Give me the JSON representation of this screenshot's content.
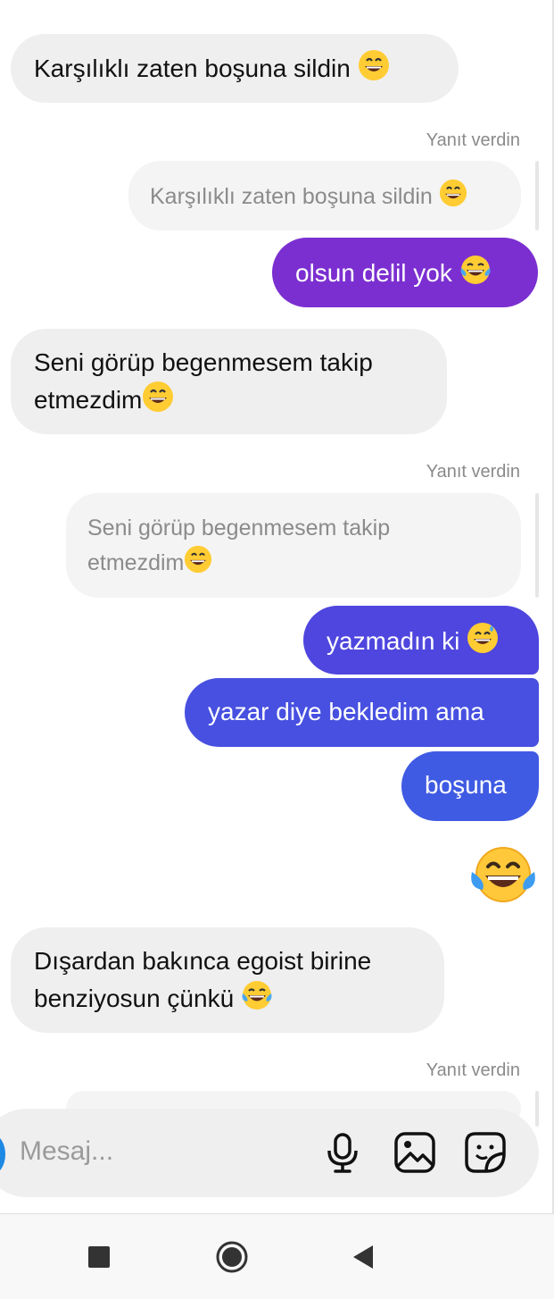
{
  "messages": [
    {
      "id": "m1",
      "text": "Karşılıklı zaten boşuna sildin",
      "emoji": "grin"
    },
    {
      "id": "m2",
      "meta": "Yanıt verdin",
      "quote": "Karşılıklı zaten boşuna sildin",
      "quote_emoji": "grin"
    },
    {
      "id": "m3",
      "text": "olsun delil yok",
      "emoji": "tears-of-joy",
      "color": "#7b2fd0"
    },
    {
      "id": "m4",
      "line1": "Seni görüp begenmesem takip",
      "line2": "etmezdim",
      "emoji": "grin"
    },
    {
      "id": "m5",
      "meta": "Yanıt verdin",
      "quote_line1": "Seni görüp begenmesem takip",
      "quote_line2": "etmezdim",
      "quote_emoji": "grin"
    },
    {
      "id": "m6",
      "text": "yazmadın ki",
      "emoji": "sweat-smile",
      "color": "#4e46de"
    },
    {
      "id": "m7",
      "text": "yazar diye bekledim ama",
      "color": "#4750e0"
    },
    {
      "id": "m8",
      "text": "boşuna",
      "color": "#3f5be3"
    },
    {
      "id": "m9",
      "emoji": "tears-of-joy",
      "standalone": true
    },
    {
      "id": "m10",
      "line1": "Dışardan bakınca egoist birine",
      "line2": "benziyosun çünkü",
      "emoji": "tears-of-joy"
    },
    {
      "id": "m11",
      "meta": "Yanıt verdin"
    }
  ],
  "composer": {
    "placeholder": "Mesaj...",
    "icons": [
      "microphone-icon",
      "image-icon",
      "sticker-icon"
    ]
  },
  "navbar": {
    "icons": [
      "recent-apps-icon",
      "home-icon",
      "back-icon"
    ]
  },
  "colors": {
    "incoming": "#efefef",
    "quote": "#f4f4f4",
    "purple": "#7b2fd0",
    "blue": "#4750e0",
    "accent": "#1e88e5"
  }
}
